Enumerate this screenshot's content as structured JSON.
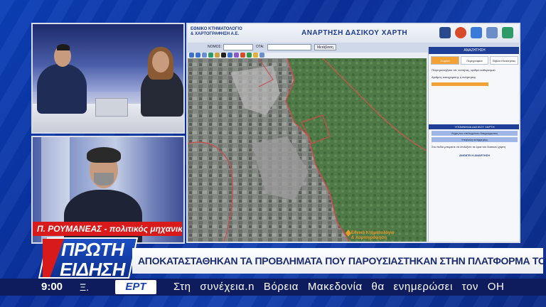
{
  "map_app": {
    "org_line1": "ΕΘΝΙΚΟ ΚΤΗΜΑΤΟΛΟΓΙΟ",
    "org_line2": "& ΧΑΡΤΟΓΡΑΦΗΣΗ Α.Ε.",
    "title": "ΑΝΑΡΤΗΣΗ ΔΑΣΙΚΟΥ ΧΑΡΤΗ",
    "nomos_label": "ΝΟΜΟΣ:",
    "ota_label": "ΟΤΑ:",
    "go_button": "Μετάβαση",
    "panel": {
      "header": "ΑΝΑΖΗΤΗΣΗ",
      "tabs": [
        "Χωρικά",
        "Περιγραφικά",
        "Βιβλίο Ιδιοκτησίας"
      ],
      "text1": "Πληκτρολογήστε αίτ. ενότητας, αριθμό καθορισμού",
      "text2": "Αριθμός καταχώρισης ή ανάρτησης",
      "section": "ΥΠΟΜΝΗΜΑ ΔΑΣΙΚΟΥ ΧΑΡΤΗ",
      "btn1": "Λήψη του επιλεγμένου διαγράμματος",
      "btn2": "Υποβολή αντίρρησης",
      "text3": "Στο πεδίο μπορείτε να επιλέξετε τα όρια του δασικού χάρτη",
      "link": "ΑΝΟΙΓΕΙ Η ΑΝΑΡΤΗΣΗ"
    },
    "watermark_1": "Εθνικό Κτηματολόγιο",
    "watermark_2": "& Χαρτογράφηση"
  },
  "guest_caption": "Π. ΡΟΥΜΑΝΕΑΣ - πολιτικός μηχανικός",
  "brand": {
    "line1": "ΠΡΩΤΗ",
    "line2": "ΕΙΔΗΣΗ"
  },
  "headline": "ΑΠΟΚΑΤΑΣΤΑΘΗΚΑΝ ΤΑ ΠΡΟΒΛΗΜΑΤΑ ΠΟΥ ΠΑΡΟΥΣΙΑΣΤΗΚΑΝ ΣΤΗΝ ΠΛΑΤΦΟΡΜΑ ΤΟΥ ΚΤΗΜΑΤΟΛΟΓΙΟΥ",
  "ticker": {
    "time": "9:00",
    "prefix": "Ξ.",
    "channel": "ΕΡΤ",
    "text": "Στη συνέχεια.n Βόρεια Μακεδονία θα ενημερώσει τον ΟΗ"
  },
  "colors": {
    "accent_red": "#d81a1a",
    "accent_blue": "#1f3f96",
    "orange": "#f2a234"
  }
}
